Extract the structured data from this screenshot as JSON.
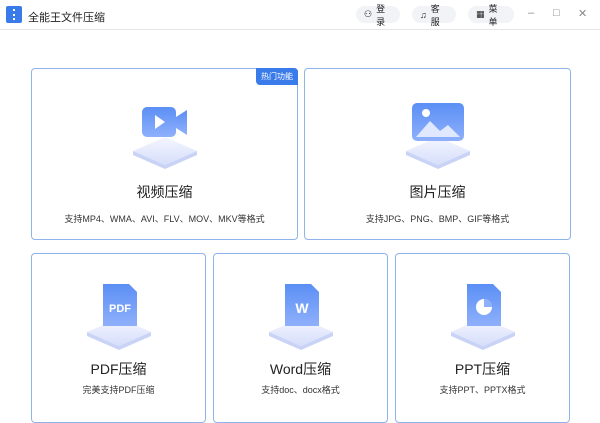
{
  "app": {
    "title": "全能王文件压缩"
  },
  "toolbar": {
    "login": "登录",
    "service": "客服",
    "menu": "菜单"
  },
  "colors": {
    "accent": "#3a7bea",
    "border": "#8fb4ec"
  },
  "cards": [
    {
      "title": "视频压缩",
      "sub": "支持MP4、WMA、AVI、FLV、MOV、MKV等格式",
      "badge": "热门功能",
      "icon": "video-icon"
    },
    {
      "title": "图片压缩",
      "sub": "支持JPG、PNG、BMP、GIF等格式",
      "icon": "image-icon"
    },
    {
      "title": "PDF压缩",
      "sub": "完美支持PDF压缩",
      "icon": "pdf-icon",
      "icon_text": "PDF"
    },
    {
      "title": "Word压缩",
      "sub": "支持doc、docx格式",
      "icon": "word-icon",
      "icon_text": "W"
    },
    {
      "title": "PPT压缩",
      "sub": "支持PPT、PPTX格式",
      "icon": "ppt-icon"
    }
  ]
}
